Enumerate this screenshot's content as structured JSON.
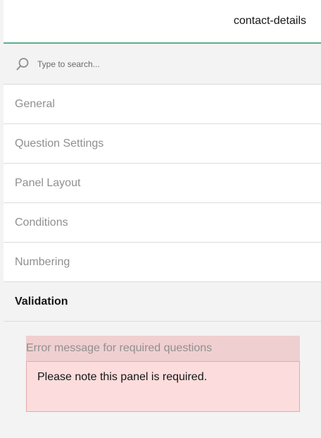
{
  "header": {
    "title": "contact-details"
  },
  "search": {
    "placeholder": "Type to search..."
  },
  "sections": [
    {
      "label": "General"
    },
    {
      "label": "Question Settings"
    },
    {
      "label": "Panel Layout"
    },
    {
      "label": "Conditions"
    },
    {
      "label": "Numbering"
    },
    {
      "label": "Validation"
    }
  ],
  "validation": {
    "field_title": "Error message for required questions",
    "field_value": "Please note this panel is required."
  },
  "colors": {
    "accent": "#5fae8c",
    "error_background": "#fcdcdc",
    "error_title_background": "#f0cfd0"
  }
}
